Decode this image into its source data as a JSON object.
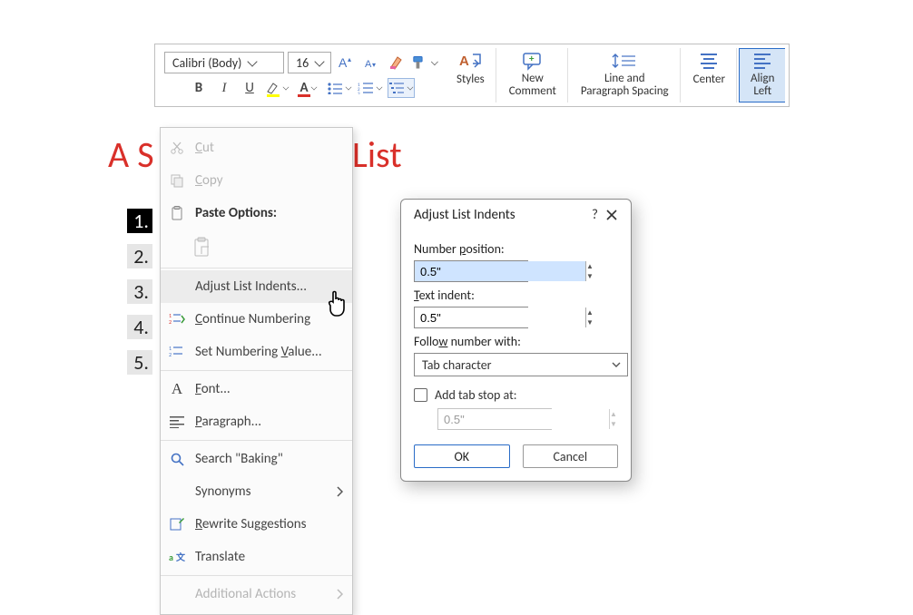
{
  "ribbon": {
    "font_name": "Calibri (Body)",
    "font_size": "16",
    "bold": "B",
    "italic": "I",
    "underline": "U",
    "styles": "Styles",
    "new_comment_l1": "New",
    "new_comment_l2": "Comment",
    "line_spacing_l1": "Line and",
    "line_spacing_l2": "Paragraph Spacing",
    "center": "Center",
    "align_left_l1": "Align",
    "align_left_l2": "Left"
  },
  "document": {
    "title_left": "A S",
    "title_right": " List",
    "numbers": [
      "1.",
      "2.",
      "3.",
      "4.",
      "5."
    ]
  },
  "context_menu": {
    "cut": "Cut",
    "copy": "Copy",
    "paste_options": "Paste Options:",
    "adjust": "Adjust List Indents...",
    "continue_numbering": "Continue Numbering",
    "set_value": "Set Numbering Value...",
    "font": "Font...",
    "paragraph": "Paragraph...",
    "search": "Search \"Baking\"",
    "synonyms": "Synonyms",
    "rewrite": "Rewrite Suggestions",
    "translate": "Translate",
    "additional": "Additional Actions"
  },
  "dialog": {
    "title": "Adjust List Indents",
    "number_position_label": "Number position:",
    "number_position_value": "0.5\"",
    "text_indent_label": "Text indent:",
    "text_indent_value": "0.5\"",
    "follow_label": "Follow number with:",
    "follow_value": "Tab character",
    "add_tab_label": "Add tab stop at:",
    "add_tab_value": "0.5\"",
    "ok": "OK",
    "cancel": "Cancel"
  }
}
